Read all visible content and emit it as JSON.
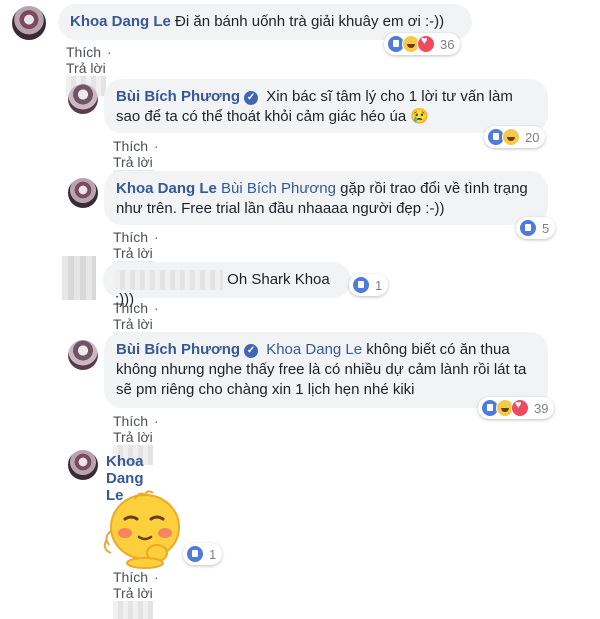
{
  "actions": {
    "like": "Thích",
    "reply": "Trả lời",
    "separator": "·"
  },
  "comments": [
    {
      "name": "Khoa Dang Le",
      "text": "Đi ăn bánh uốnh trà giải khuây em ơi :-))",
      "reactions": "36"
    },
    {
      "name": "Bùi Bích Phương",
      "text": "Xin bác sĩ tâm lý cho 1 lời tư vấn làm sao để ta có thể thoát khỏi cảm giác héo úa 😢",
      "reactions": "20"
    },
    {
      "name": "Khoa Dang Le",
      "tag": "Bùi Bích Phương",
      "text": "gặp rồi trao đổi về tình trạng như trên. Free trial lần đầu nhaaaa người đẹp :-))",
      "reactions": "5"
    },
    {
      "name": "",
      "text": "Oh Shark Khoa :)))",
      "reactions": "1"
    },
    {
      "name": "Bùi Bích Phương",
      "tag": "Khoa Dang Le",
      "text": "không biết có ăn thua không nhưng nghe thấy free là có nhiều dự cảm lành rồi lát ta sẽ pm riêng cho chàng xin 1 lịch hẹn nhé kiki",
      "reactions": "39"
    },
    {
      "name": "Khoa Dang Le",
      "reactions": "1"
    }
  ]
}
